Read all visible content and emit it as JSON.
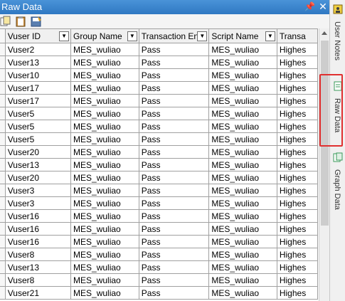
{
  "panel": {
    "title": "Raw Data"
  },
  "columns": [
    "Vuser ID",
    "Group Name",
    "Transaction End",
    "Script Name",
    "Transa"
  ],
  "rows": [
    [
      "Vuser2",
      "MES_wuliao",
      "Pass",
      "MES_wuliao",
      "Highes"
    ],
    [
      "Vuser13",
      "MES_wuliao",
      "Pass",
      "MES_wuliao",
      "Highes"
    ],
    [
      "Vuser10",
      "MES_wuliao",
      "Pass",
      "MES_wuliao",
      "Highes"
    ],
    [
      "Vuser17",
      "MES_wuliao",
      "Pass",
      "MES_wuliao",
      "Highes"
    ],
    [
      "Vuser17",
      "MES_wuliao",
      "Pass",
      "MES_wuliao",
      "Highes"
    ],
    [
      "Vuser5",
      "MES_wuliao",
      "Pass",
      "MES_wuliao",
      "Highes"
    ],
    [
      "Vuser5",
      "MES_wuliao",
      "Pass",
      "MES_wuliao",
      "Highes"
    ],
    [
      "Vuser5",
      "MES_wuliao",
      "Pass",
      "MES_wuliao",
      "Highes"
    ],
    [
      "Vuser20",
      "MES_wuliao",
      "Pass",
      "MES_wuliao",
      "Highes"
    ],
    [
      "Vuser13",
      "MES_wuliao",
      "Pass",
      "MES_wuliao",
      "Highes"
    ],
    [
      "Vuser20",
      "MES_wuliao",
      "Pass",
      "MES_wuliao",
      "Highes"
    ],
    [
      "Vuser3",
      "MES_wuliao",
      "Pass",
      "MES_wuliao",
      "Highes"
    ],
    [
      "Vuser3",
      "MES_wuliao",
      "Pass",
      "MES_wuliao",
      "Highes"
    ],
    [
      "Vuser16",
      "MES_wuliao",
      "Pass",
      "MES_wuliao",
      "Highes"
    ],
    [
      "Vuser16",
      "MES_wuliao",
      "Pass",
      "MES_wuliao",
      "Highes"
    ],
    [
      "Vuser16",
      "MES_wuliao",
      "Pass",
      "MES_wuliao",
      "Highes"
    ],
    [
      "Vuser8",
      "MES_wuliao",
      "Pass",
      "MES_wuliao",
      "Highes"
    ],
    [
      "Vuser13",
      "MES_wuliao",
      "Pass",
      "MES_wuliao",
      "Highes"
    ],
    [
      "Vuser8",
      "MES_wuliao",
      "Pass",
      "MES_wuliao",
      "Highes"
    ],
    [
      "Vuser21",
      "MES_wuliao",
      "Pass",
      "MES_wuliao",
      "Highes"
    ]
  ],
  "sidebar": {
    "tabs": [
      {
        "label": "User Notes",
        "icon": "user-notes-icon"
      },
      {
        "label": "Raw Data",
        "icon": "raw-data-icon",
        "active": true
      },
      {
        "label": "Graph Data",
        "icon": "graph-data-icon"
      }
    ]
  },
  "colors": {
    "titlebar": "#3a86cf",
    "highlight": "#e03030"
  }
}
